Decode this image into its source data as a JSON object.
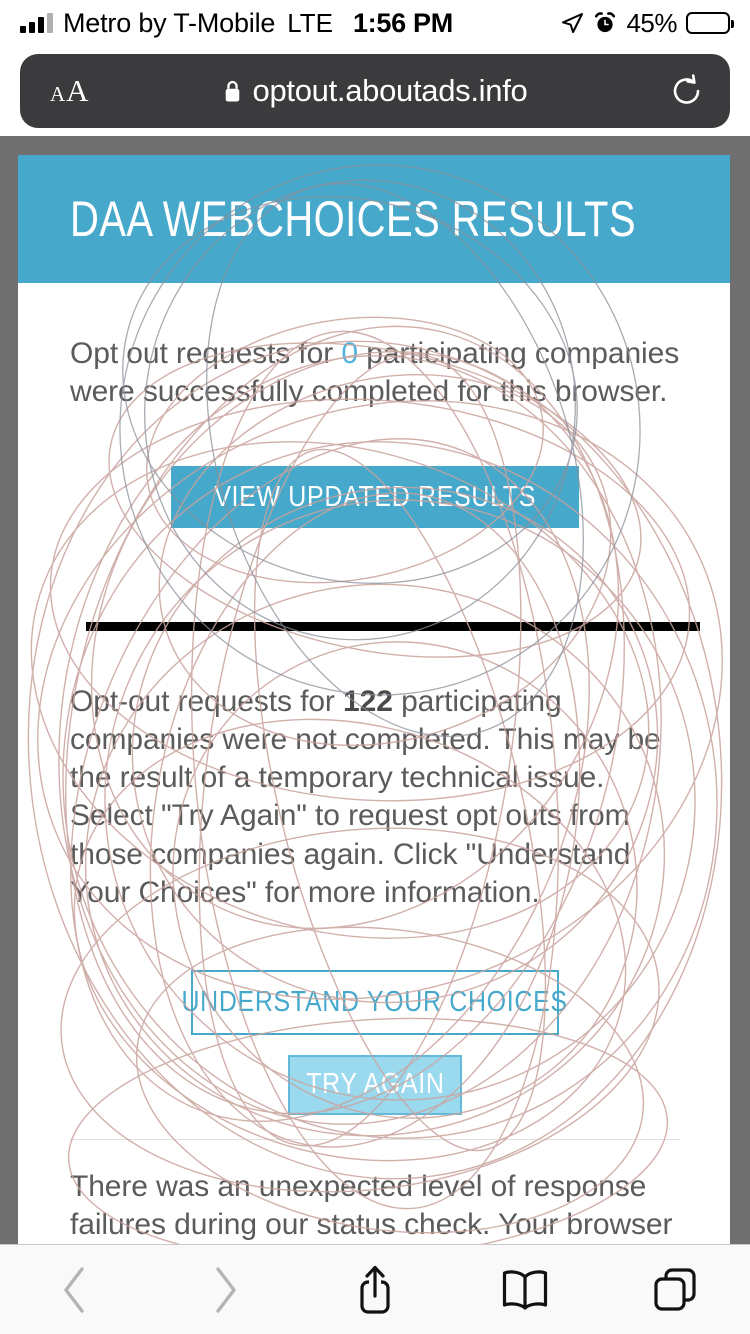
{
  "status_bar": {
    "carrier": "Metro by T-Mobile",
    "network": "LTE",
    "time": "1:56 PM",
    "battery_percent": "45%",
    "battery_level": 45,
    "icons": [
      "signal-bars-icon",
      "location-arrow-icon",
      "alarm-clock-icon",
      "battery-icon"
    ]
  },
  "browser": {
    "text_size_button": {
      "small_a": "A",
      "large_a": "A"
    },
    "url": "optout.aboutads.info",
    "secure": true,
    "reload_label": "Reload",
    "toolbar": {
      "back_label": "Back",
      "forward_label": "Forward",
      "share_label": "Share",
      "bookmarks_label": "Bookmarks",
      "tabs_label": "Tabs"
    }
  },
  "page": {
    "header_title": "DAA WEBCHOICES RESULTS",
    "success": {
      "text_before": "Opt out requests for",
      "count": "0",
      "text_after": "participating companies were successfully completed for this browser.",
      "button_label": "VIEW UPDATED RESULTS"
    },
    "failure": {
      "text_before": "Opt-out requests for",
      "count": "122",
      "text_after": "participating companies were not completed. This may be the result of a temporary technical issue. Select \"Try Again\" to request opt outs from those companies again. Click \"Understand Your Choices\" for more information.",
      "understand_button_label": "UNDERSTAND YOUR CHOICES",
      "try_again_button_label": "TRY AGAIN"
    },
    "notice": "There was an unexpected level of response failures during our status check. Your browser settings or extensions may be interfering with the intended"
  },
  "colors": {
    "brand_blue": "#46a8cb",
    "light_blue": "#9bd9ee",
    "accent_count_blue": "#4fb4dc",
    "body_text": "#5b5b5b",
    "page_backdrop": "#6f6f6f",
    "urlbar_bg": "#3b3b3d",
    "scribble": "#c9a39d"
  }
}
